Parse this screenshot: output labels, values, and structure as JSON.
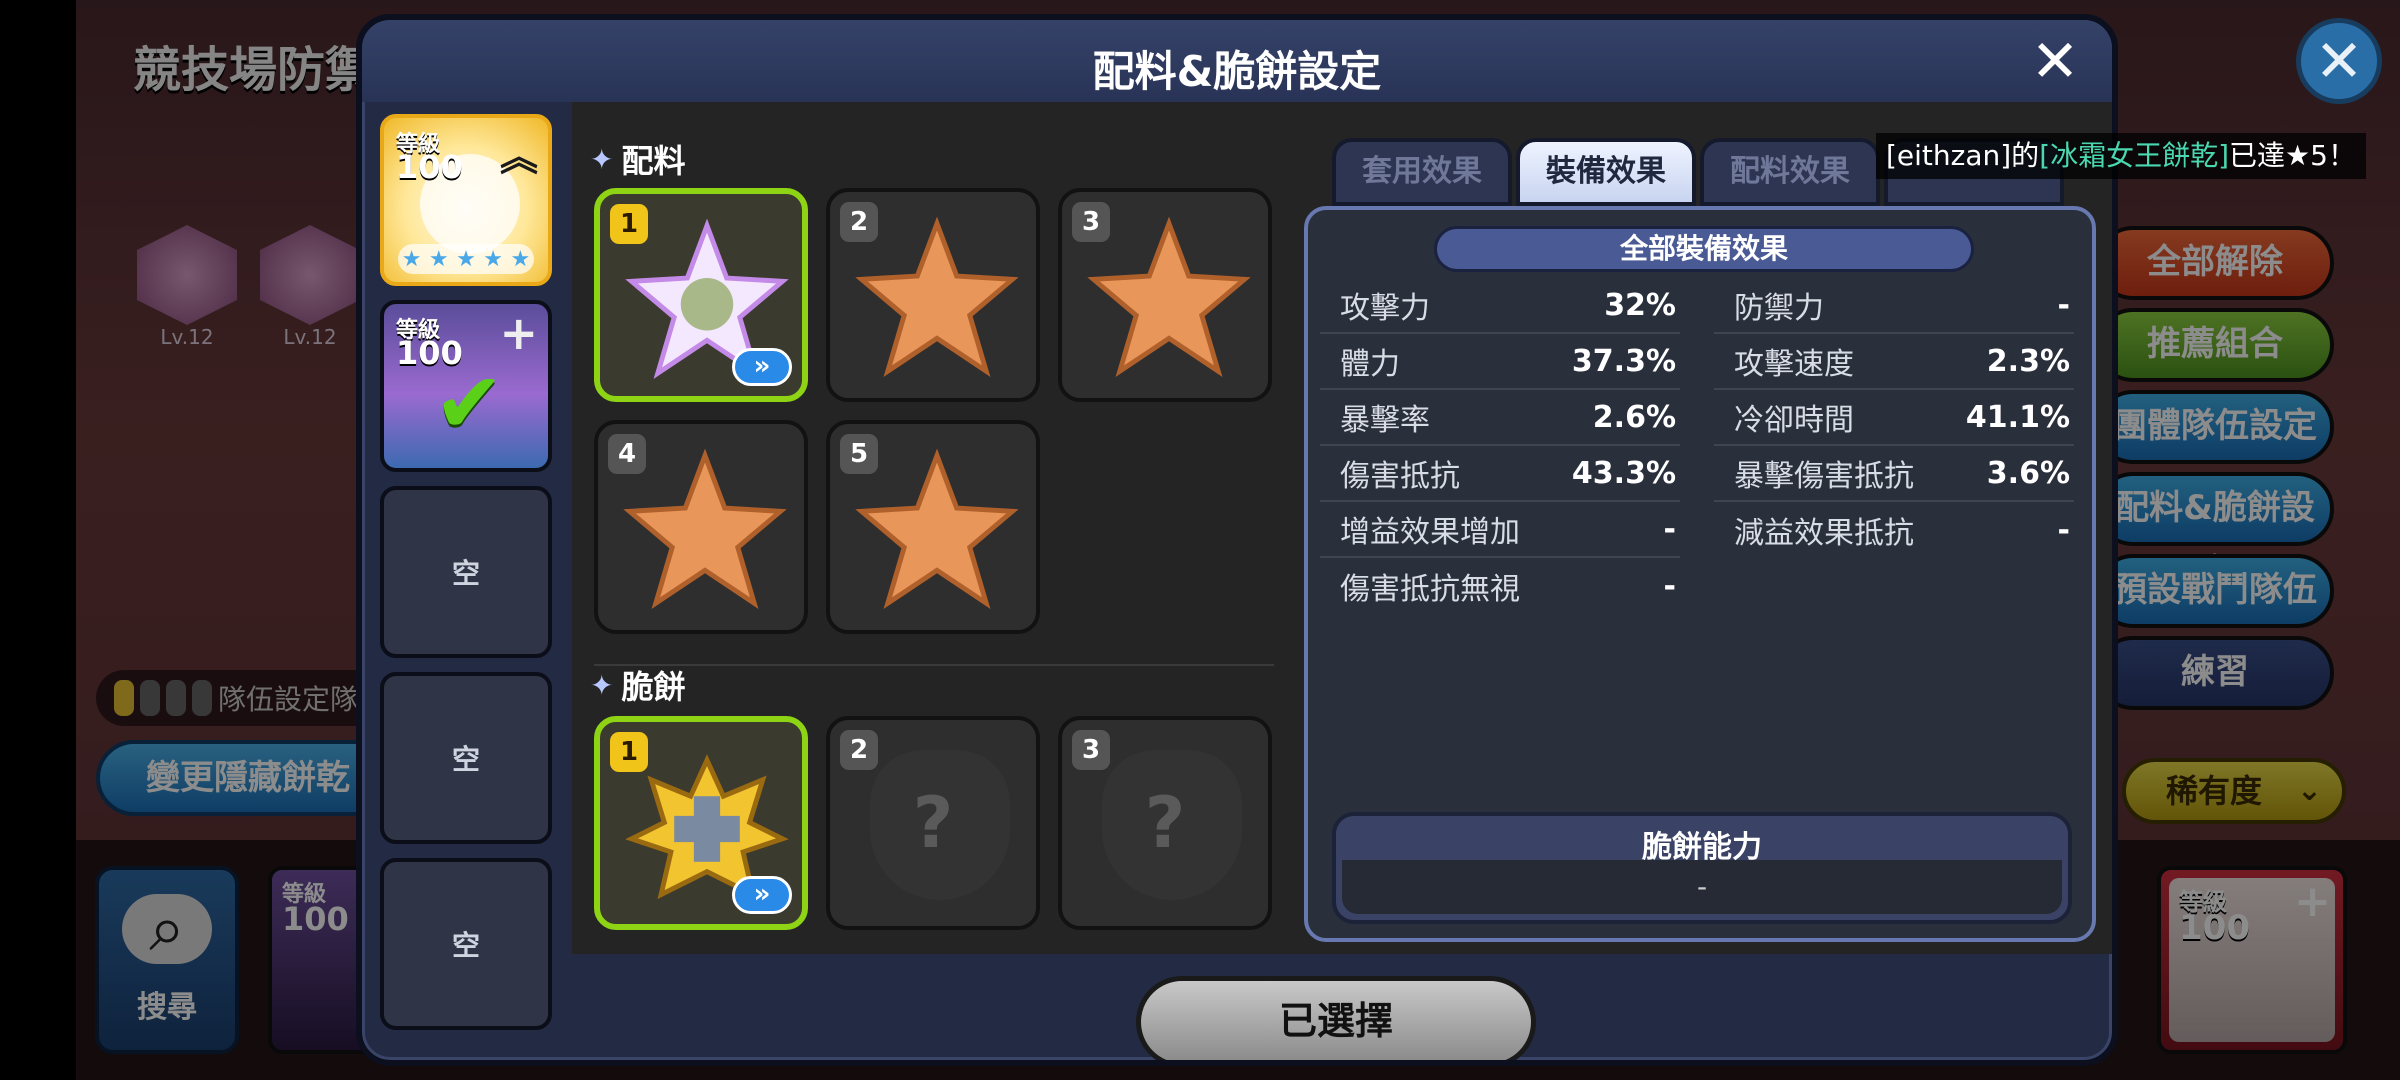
{
  "background": {
    "screen_title": "競技場防禦",
    "pets": [
      {
        "level": "Lv.12"
      },
      {
        "level": "Lv.12"
      }
    ],
    "team_settings_label": "隊伍設定隊",
    "change_hidden_cookie_label": "變更隱藏餅乾",
    "search_label": "搜尋",
    "left_card": {
      "level_label": "等級",
      "level": "100"
    },
    "right_buttons": [
      "全部解除",
      "推薦組合",
      "團體隊伍設定",
      "配料&脆餅設定",
      "預設戰鬥隊伍",
      "練習"
    ],
    "rarity_filter": "稀有度",
    "right_card": {
      "level_label": "等級",
      "level": "100"
    }
  },
  "modal": {
    "title": "配料&脆餅設定",
    "cookies": [
      {
        "level_label": "等級",
        "level": "100",
        "stars": 5
      },
      {
        "level_label": "等級",
        "level": "100"
      },
      {
        "empty_label": "空"
      },
      {
        "empty_label": "空"
      },
      {
        "empty_label": "空"
      }
    ],
    "toppings": {
      "section_label": "配料",
      "slots": [
        "1",
        "2",
        "3",
        "4",
        "5"
      ]
    },
    "biscuits": {
      "section_label": "脆餅",
      "slots": [
        "1",
        "2",
        "3"
      ]
    },
    "tabs": [
      "套用效果",
      "裝備效果",
      "配料效果"
    ],
    "active_tab": "裝備效果",
    "notice": {
      "prefix": "[eithzan]的",
      "highlight": "[冰霜女王餅乾]",
      "suffix": "已達★5！"
    },
    "effects": {
      "header": "全部裝備效果",
      "left": [
        {
          "label": "攻擊力",
          "value": "32%"
        },
        {
          "label": "體力",
          "value": "37.3%"
        },
        {
          "label": "暴擊率",
          "value": "2.6%"
        },
        {
          "label": "傷害抵抗",
          "value": "43.3%"
        },
        {
          "label": "增益效果增加",
          "value": "-"
        },
        {
          "label": "傷害抵抗無視",
          "value": "-"
        }
      ],
      "right": [
        {
          "label": "防禦力",
          "value": "-"
        },
        {
          "label": "攻擊速度",
          "value": "2.3%"
        },
        {
          "label": "冷卻時間",
          "value": "41.1%"
        },
        {
          "label": "暴擊傷害抵抗",
          "value": "3.6%"
        },
        {
          "label": "減益效果抵抗",
          "value": "-"
        }
      ],
      "ability_title": "脆餅能力",
      "ability_value": "-"
    },
    "select_button": "已選擇"
  },
  "colors": {
    "selected_border": "#8ed414",
    "number_badge_gold": "#f0c418",
    "notice_highlight": "#4ad8b0",
    "modal_bg": "#232a44"
  }
}
